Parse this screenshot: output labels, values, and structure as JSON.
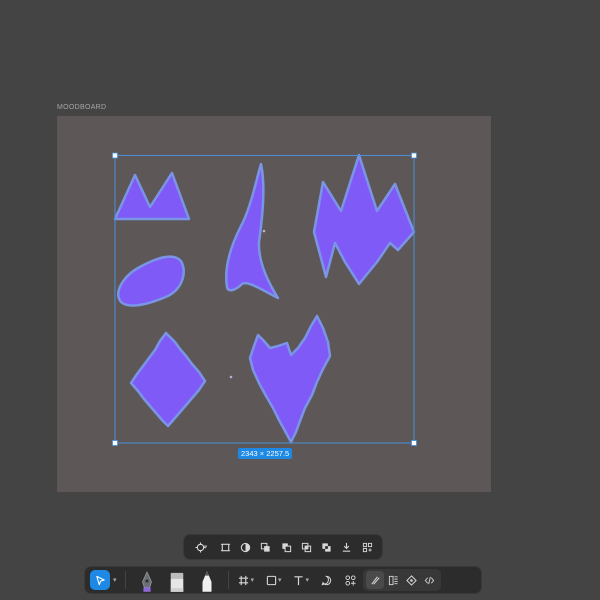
{
  "frame": {
    "label": "MOODBOARD"
  },
  "selection": {
    "dimensions": "2343 × 2257.5"
  },
  "colors": {
    "background": "#444444",
    "canvas": "#5d5757",
    "shape_fill": "#7f5af7",
    "shape_stroke": "#7b95e6",
    "selection": "#4a8fd8",
    "accent": "#1e88e5"
  },
  "context_toolbar": {
    "icons": [
      "component-target-icon",
      "frame-icon",
      "mask-icon",
      "union-icon",
      "subtract-icon",
      "intersect-icon",
      "exclude-icon",
      "flatten-icon",
      "more-icon"
    ]
  },
  "main_toolbar": {
    "tools": [
      "move-tool-icon",
      "pen-tool-icon",
      "marker-tool-icon",
      "pencil-tool-icon",
      "frame-tool-icon",
      "rectangle-tool-icon",
      "text-tool-icon",
      "comment-tool-icon",
      "actions-icon"
    ],
    "dev": [
      "draw-mode-icon",
      "design-mode-icon",
      "prototype-mode-icon",
      "dev-mode-icon"
    ]
  }
}
